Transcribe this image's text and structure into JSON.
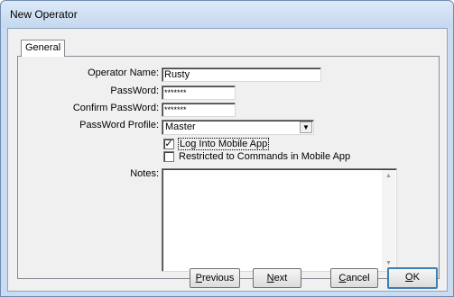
{
  "window": {
    "title": "New Operator"
  },
  "tabs": [
    {
      "label": "General"
    }
  ],
  "form": {
    "operator_name": {
      "label": "Operator Name:",
      "value": "Rusty"
    },
    "password": {
      "label": "PassWord:",
      "value": "*******"
    },
    "confirm_password": {
      "label": "Confirm PassWord:",
      "value": "*******"
    },
    "password_profile": {
      "label": "PassWord Profile:",
      "value": "Master",
      "arrow": "▼"
    },
    "log_into_mobile": {
      "label": "Log Into Mobile App",
      "checked": true,
      "mark": "✓"
    },
    "restricted_commands": {
      "label": "Restricted to Commands in Mobile App",
      "checked": false
    },
    "notes": {
      "label": "Notes:",
      "value": ""
    }
  },
  "scroll": {
    "up": "▲",
    "down": "▼"
  },
  "buttons": {
    "previous": {
      "mnemonic": "P",
      "rest": "revious"
    },
    "next": {
      "mnemonic": "N",
      "rest": "ext"
    },
    "cancel": {
      "mnemonic": "C",
      "rest": "ancel"
    },
    "ok": {
      "mnemonic": "O",
      "rest": "K"
    }
  }
}
